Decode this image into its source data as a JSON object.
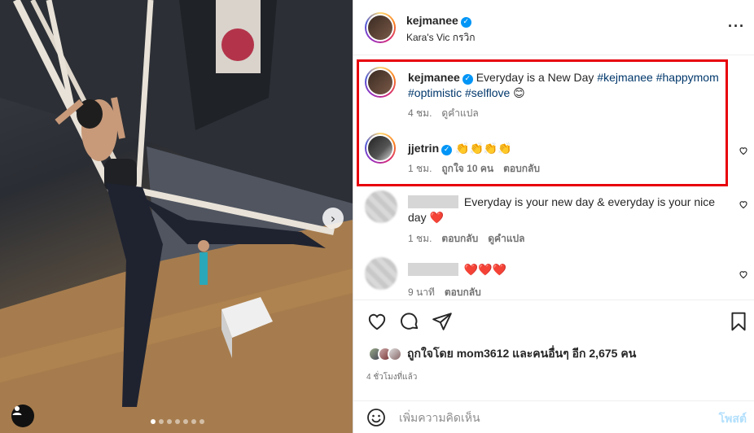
{
  "post": {
    "author": "kejmanee",
    "location": "Kara's Vic กรวิก",
    "caption_text": "Everyday is a New Day",
    "caption_tags_line1": "#kejmanee #happymom",
    "caption_tags_line2": "#optimistic #selflove",
    "caption_emoji": "😊",
    "caption_time": "4 ชม.",
    "translate_label": "ดูคำแปล",
    "photo_dot_count": 7,
    "photo_active_dot": 1
  },
  "comments": [
    {
      "username": "jjetrin",
      "text": "👏👏👏👏",
      "time": "1 ชม.",
      "likes": "ถูกใจ 10 คน",
      "reply": "ตอบกลับ"
    },
    {
      "username": "",
      "text_line1": "Everyday is your new day & everyday is your nice",
      "text_line2": "day",
      "emoji": "❤️",
      "time": "1 ชม.",
      "reply": "ตอบกลับ",
      "translate": "ดูคำแปล"
    },
    {
      "username": "",
      "text": "❤️❤️❤️",
      "time": "9 นาที",
      "reply": "ตอบกลับ"
    }
  ],
  "likes": {
    "summary": "ถูกใจโดย mom3612 และคนอื่นๆ อีก 2,675 คน"
  },
  "timestamp": "4 ชั่วโมงที่แล้ว",
  "composer": {
    "placeholder": "เพิ่มความคิดเห็น",
    "post_label": "โพสต์"
  },
  "icons": {
    "more": "more-options-icon",
    "like": "heart-icon",
    "comment": "comment-icon",
    "share": "share-icon",
    "save": "bookmark-icon",
    "emoji": "emoji-icon",
    "next": "chevron-right-icon",
    "tag": "user-tag-icon"
  },
  "colors": {
    "accent": "#0095f6",
    "hashtag": "#00376b",
    "highlight": "#e8000b",
    "heart": "#ed4956"
  }
}
